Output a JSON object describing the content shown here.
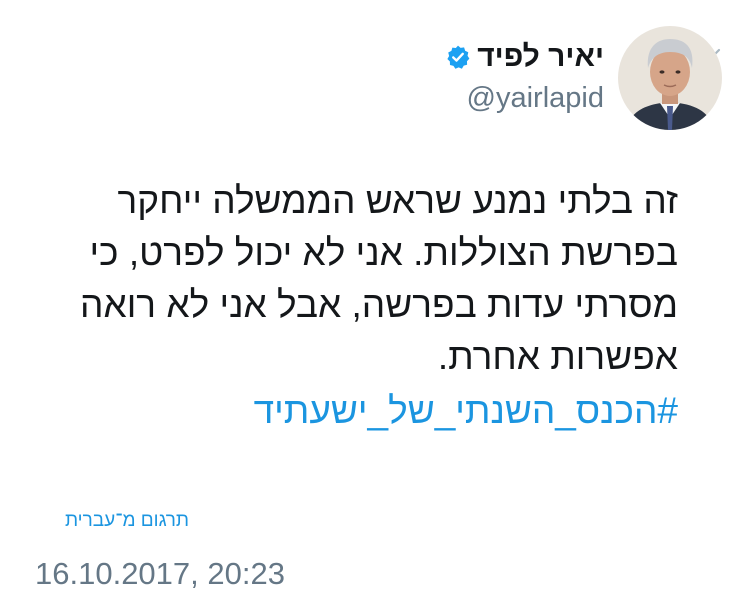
{
  "author": {
    "display_name": "יאיר לפיד",
    "handle": "@yairlapid",
    "verified": true
  },
  "tweet": {
    "lines": [
      "זה בלתי נמנע שראש הממשלה ייחקר",
      "בפרשת הצוללות. אני לא יכול לפרט, כי",
      "מסרתי עדות בפרשה, אבל אני לא רואה",
      "אפשרות אחרת."
    ],
    "hashtag": "#הכנס_השנתי_של_ישעתיד"
  },
  "translate_label": "תרגום מ־עברית",
  "timestamp": "16.10.2017, 20:23",
  "colors": {
    "link": "#1b95e0",
    "secondary_text": "#657786",
    "verified_badge": "#1da1f2"
  },
  "icons": {
    "menu": "chevron-down-icon",
    "verified": "verified-badge-icon"
  }
}
